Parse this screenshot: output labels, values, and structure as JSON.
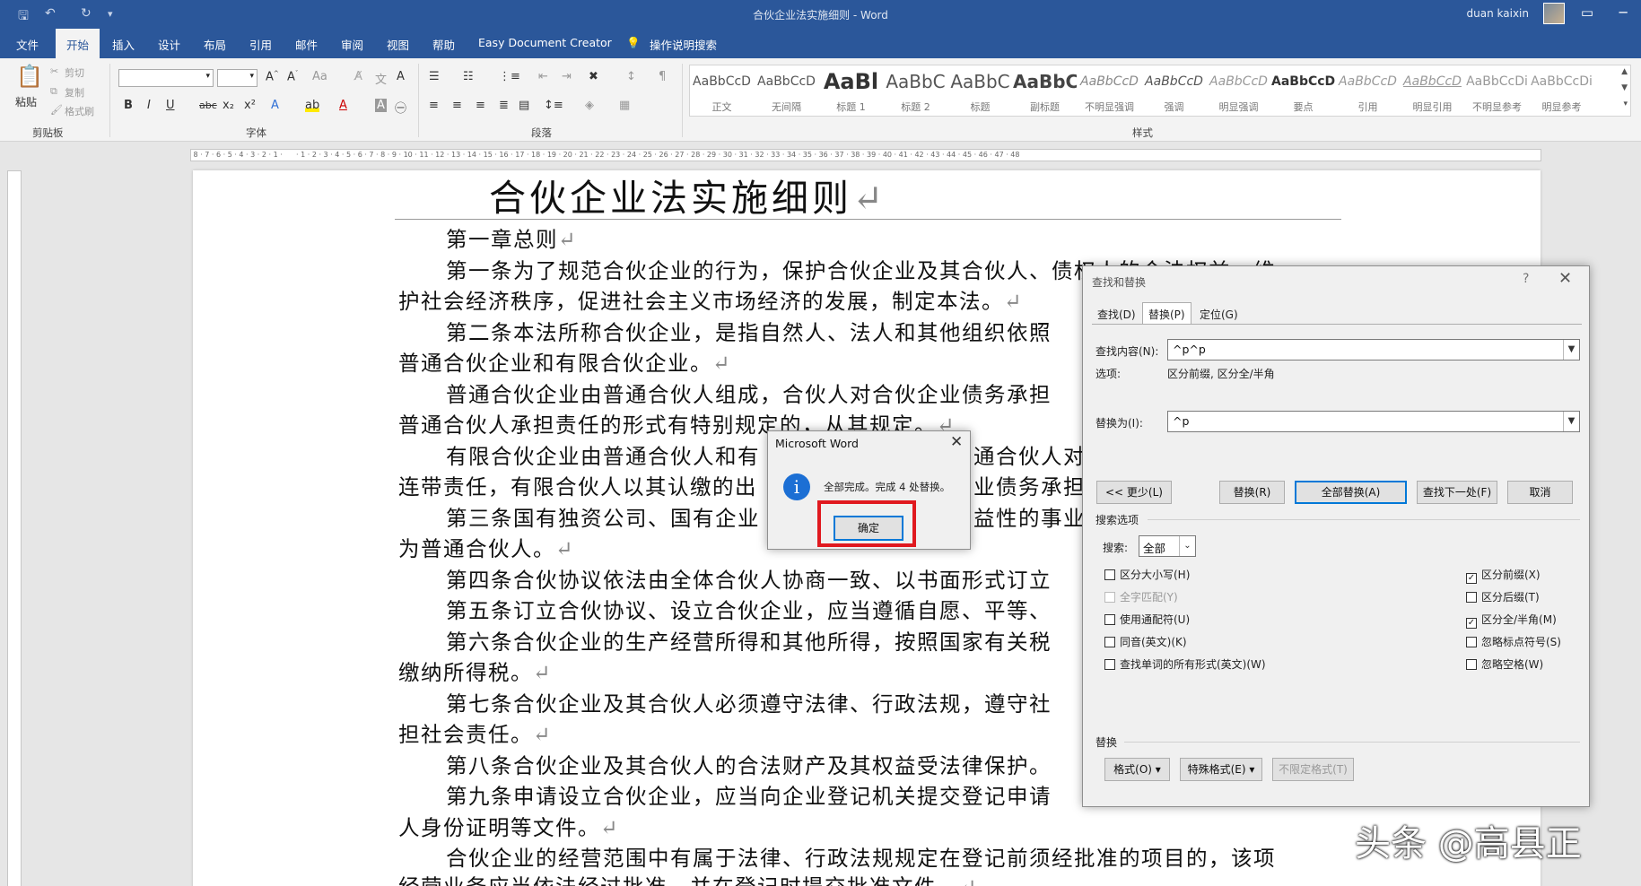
{
  "window": {
    "title": "合伙企业法实施细则 - Word",
    "user": "duan kaixin"
  },
  "menu": [
    "文件",
    "开始",
    "插入",
    "设计",
    "布局",
    "引用",
    "邮件",
    "审阅",
    "视图",
    "帮助",
    "Easy Document Creator"
  ],
  "tell_me": "操作说明搜索",
  "ribbon": {
    "clipboard": {
      "paste": "粘贴",
      "cut": "剪切",
      "copy": "复制",
      "format_painter": "格式刷",
      "label": "剪贴板"
    },
    "font_label": "字体",
    "paragraph_label": "段落",
    "styles_label": "样式",
    "styles": [
      {
        "preview": "AaBbCcD",
        "name": "正文"
      },
      {
        "preview": "AaBbCcD",
        "name": "无间隔"
      },
      {
        "preview": "AaBl",
        "name": "标题 1"
      },
      {
        "preview": "AaBbC",
        "name": "标题 2"
      },
      {
        "preview": "AaBbC",
        "name": "标题"
      },
      {
        "preview": "AaBbC",
        "name": "副标题"
      },
      {
        "preview": "AaBbCcD",
        "name": "不明显强调"
      },
      {
        "preview": "AaBbCcD",
        "name": "强调"
      },
      {
        "preview": "AaBbCcD",
        "name": "明显强调"
      },
      {
        "preview": "AaBbCcD",
        "name": "要点"
      },
      {
        "preview": "AaBbCcD",
        "name": "引用"
      },
      {
        "preview": "AaBbCcD",
        "name": "明显引用"
      },
      {
        "preview": "AaBbCcDi",
        "name": "不明显参考"
      },
      {
        "preview": "AaBbCcDi",
        "name": "明显参考"
      }
    ]
  },
  "document": {
    "title": "合伙企业法实施细则",
    "lines": [
      {
        "t": "第一章总则"
      },
      {
        "t": "第一条为了规范合伙企业的行为，保护合伙企业及其合伙人、债权人的合法权益，维"
      },
      {
        "t": "护社会经济秩序，促进社会主义市场经济的发展，制定本法。"
      },
      {
        "t": "第二条本法所称合伙企业，是指自然人、法人和其他组织依照"
      },
      {
        "t": "普通合伙企业和有限合伙企业。"
      },
      {
        "t": "普通合伙企业由普通合伙人组成，合伙人对合伙企业债务承担"
      },
      {
        "t": "普通合伙人承担责任的形式有特别规定的，从其规定。"
      },
      {
        "t": "有限合伙企业由普通合伙人和有"
      },
      {
        "t": "连带责任，有限合伙人以其认缴的出"
      },
      {
        "t": "第三条国有独资公司、国有企业"
      },
      {
        "t": "为普通合伙人。"
      },
      {
        "t": "第四条合伙协议依法由全体合伙人协商一致、以书面形式订立"
      },
      {
        "t": "第五条订立合伙协议、设立合伙企业，应当遵循自愿、平等、"
      },
      {
        "t": "第六条合伙企业的生产经营所得和其他所得，按照国家有关税"
      },
      {
        "t": "缴纳所得税。"
      },
      {
        "t": "第七条合伙企业及其合伙人必须遵守法律、行政法规，遵守社"
      },
      {
        "t": "担社会责任。"
      },
      {
        "t": "第八条合伙企业及其合伙人的合法财产及其权益受法律保护。"
      },
      {
        "t": "第九条申请设立合伙企业，应当向企业登记机关提交登记申请"
      },
      {
        "t": "人身份证明等文件。"
      },
      {
        "t": "合伙企业的经营范围中有属于法律、行政法规规定在登记前须经批准的项目的，该项"
      },
      {
        "t": "经营业务应当依法经过批准，并在登记时提交批准文件。"
      }
    ],
    "fragments": {
      "f1": "通合伙人对",
      "f2": "业债务承担",
      "f3": "益性的事业"
    }
  },
  "find_replace": {
    "title": "查找和替换",
    "help": "?",
    "tabs": [
      "查找(D)",
      "替换(P)",
      "定位(G)"
    ],
    "find_label": "查找内容(N):",
    "find_value": "^p^p",
    "options_label": "选项:",
    "options_value": "区分前缀, 区分全/半角",
    "replace_label": "替换为(I):",
    "replace_value": "^p",
    "buttons": {
      "less": "<< 更少(L)",
      "replace": "替换(R)",
      "replace_all": "全部替换(A)",
      "find_next": "查找下一处(F)",
      "cancel": "取消"
    },
    "search_options_label": "搜索选项",
    "search_label": "搜索:",
    "search_value": "全部",
    "left_checks": [
      {
        "label": "区分大小写(H)",
        "checked": false,
        "disabled": false
      },
      {
        "label": "全字匹配(Y)",
        "checked": false,
        "disabled": true
      },
      {
        "label": "使用通配符(U)",
        "checked": false,
        "disabled": false
      },
      {
        "label": "同音(英文)(K)",
        "checked": false,
        "disabled": false
      },
      {
        "label": "查找单词的所有形式(英文)(W)",
        "checked": false,
        "disabled": false
      }
    ],
    "right_checks": [
      {
        "label": "区分前缀(X)",
        "checked": true
      },
      {
        "label": "区分后缀(T)",
        "checked": false
      },
      {
        "label": "区分全/半角(M)",
        "checked": true
      },
      {
        "label": "忽略标点符号(S)",
        "checked": false
      },
      {
        "label": "忽略空格(W)",
        "checked": false
      }
    ],
    "replace_section_label": "替换",
    "format_button": "格式(O) ▾",
    "special_button": "特殊格式(E) ▾",
    "no_format_button": "不限定格式(T)"
  },
  "message_box": {
    "title": "Microsoft Word",
    "text": "全部完成。完成 4 处替换。",
    "ok": "确定"
  },
  "watermark": "头条 @高县正",
  "colors": {
    "brand": "#2b579a",
    "highlight": "#e0191f",
    "focus": "#0078d7"
  }
}
